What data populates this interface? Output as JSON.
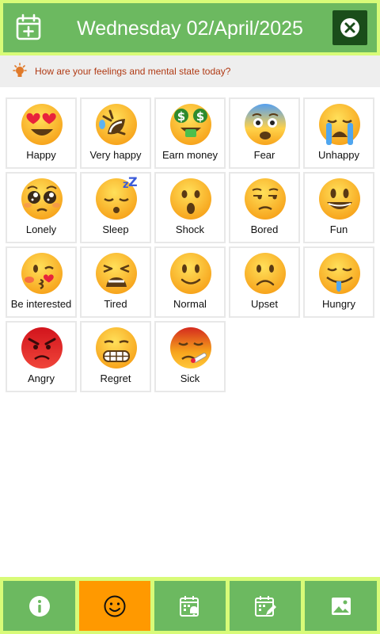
{
  "header": {
    "title": "Wednesday 02/April/2025",
    "add_icon": "calendar-plus-icon",
    "close_icon": "close-circle-icon",
    "colors": {
      "bar": "#6cb960",
      "border": "#d8fb78",
      "close_bg": "#1a4d1a"
    }
  },
  "prompt": {
    "icon": "lightbulb-icon",
    "text": "How are your feelings and mental state today?"
  },
  "emotions": [
    {
      "label": "Happy",
      "icon": "heart-eyes-face-icon"
    },
    {
      "label": "Very happy",
      "icon": "rolling-laughing-face-icon"
    },
    {
      "label": "Earn money",
      "icon": "money-mouth-face-icon"
    },
    {
      "label": "Fear",
      "icon": "fearful-face-icon"
    },
    {
      "label": "Unhappy",
      "icon": "crying-face-icon"
    },
    {
      "label": "Lonely",
      "icon": "pleading-face-icon"
    },
    {
      "label": "Sleep",
      "icon": "sleeping-face-icon"
    },
    {
      "label": "Shock",
      "icon": "hushed-face-icon"
    },
    {
      "label": "Bored",
      "icon": "unamused-face-icon"
    },
    {
      "label": "Fun",
      "icon": "grinning-face-icon"
    },
    {
      "label": "Be interested",
      "icon": "kissing-face-icon"
    },
    {
      "label": "Tired",
      "icon": "tired-face-icon"
    },
    {
      "label": "Normal",
      "icon": "slight-smile-face-icon"
    },
    {
      "label": "Upset",
      "icon": "frowning-face-icon"
    },
    {
      "label": "Hungry",
      "icon": "drooling-face-icon"
    },
    {
      "label": "Angry",
      "icon": "angry-face-icon"
    },
    {
      "label": "Regret",
      "icon": "grimacing-face-icon"
    },
    {
      "label": "Sick",
      "icon": "thermometer-face-icon"
    }
  ],
  "tabs": [
    {
      "icon": "info-icon",
      "active": false
    },
    {
      "icon": "smiley-icon",
      "active": true
    },
    {
      "icon": "calendar-alert-icon",
      "active": false
    },
    {
      "icon": "calendar-edit-icon",
      "active": false
    },
    {
      "icon": "image-icon",
      "active": false
    }
  ],
  "colors": {
    "tab": "#6cb960",
    "tab_active": "#ff9900",
    "tabbar_border": "#d8fb78"
  }
}
